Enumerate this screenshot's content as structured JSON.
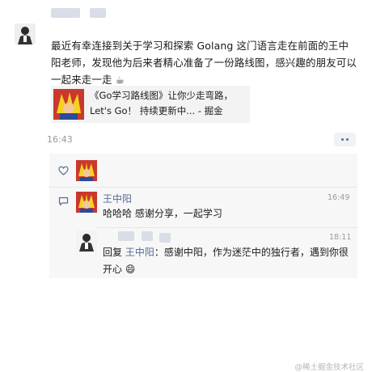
{
  "post": {
    "text": "最近有幸连接到关于学习和探索 Golang 这门语言走在前面的王中阳老师，发现他为后来者精心准备了一份路线图，感兴趣的朋友可以一起来走一走 ☕",
    "link_card": {
      "title": "《Go学习路线图》让你少走弯路，Let's Go！ 持续更新中... - 掘金"
    },
    "time": "16:43"
  },
  "comments": [
    {
      "author": "王中阳",
      "time": "16:49",
      "text": "哈哈哈 感谢分享，一起学习"
    }
  ],
  "reply": {
    "time": "18:11",
    "prefix": "回复 ",
    "target": "王中阳",
    "text": "：感谢中阳，作为迷茫中的独行者，遇到你很开心 😄"
  },
  "watermark": "@稀土掘金技术社区",
  "icons": {
    "like": "heart-outline-icon",
    "comment": "comment-icon",
    "more": "more-dots-icon"
  },
  "colors": {
    "link_name": "#576b95",
    "panel_bg": "#f7f7f7",
    "card_bg": "#f3f3f3"
  }
}
